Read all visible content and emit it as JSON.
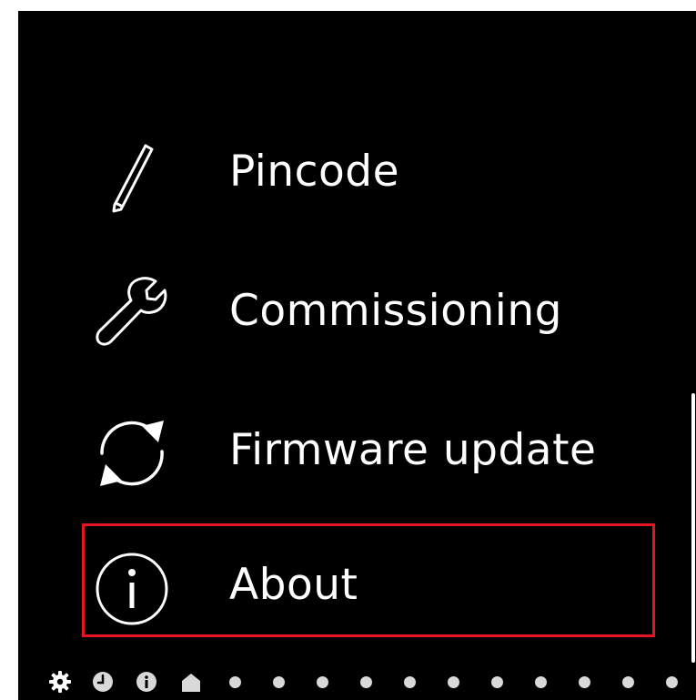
{
  "menu": {
    "items": [
      {
        "label": "Pincode",
        "icon": "pencil-icon"
      },
      {
        "label": "Commissioning",
        "icon": "wrench-icon"
      },
      {
        "label": "Firmware update",
        "icon": "refresh-icon"
      },
      {
        "label": "About",
        "icon": "info-icon",
        "selected": true
      }
    ]
  },
  "pagination": {
    "icons": [
      "gear-icon",
      "clock-icon",
      "info-icon",
      "home-icon"
    ],
    "dot_count": 11,
    "active_page": "settings"
  },
  "colors": {
    "background": "#000000",
    "text": "#ffffff",
    "selection": "#e5151f",
    "dot": "#d9d9d9"
  }
}
